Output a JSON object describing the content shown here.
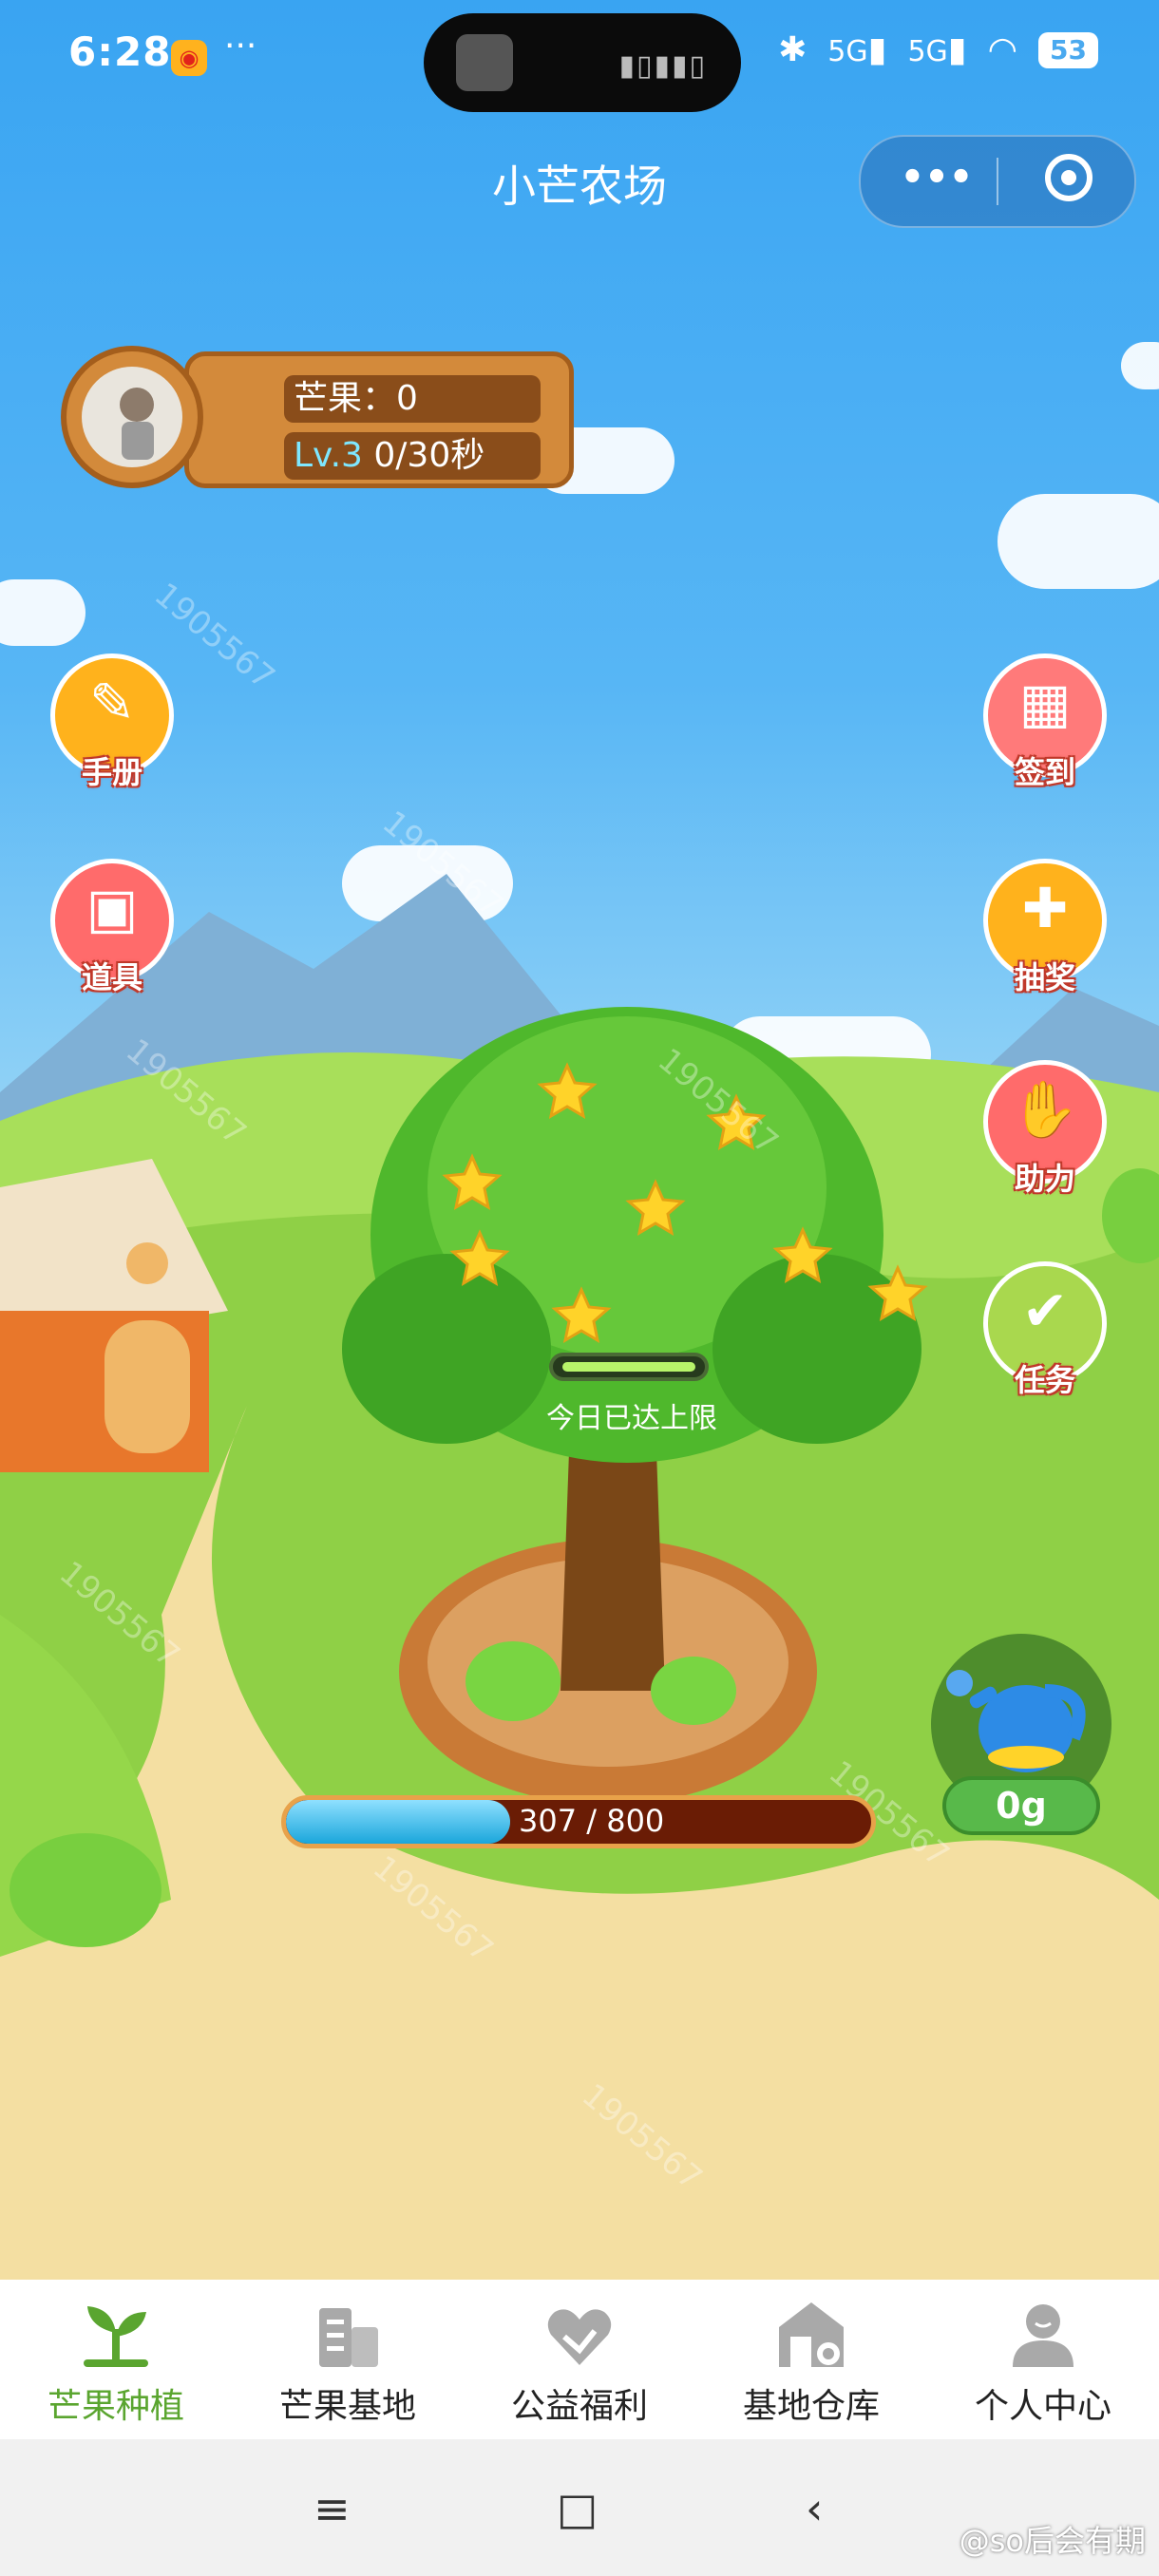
{
  "status_bar": {
    "time": "6:28",
    "more": "···",
    "network1": "5G",
    "network2": "5G",
    "battery": "53"
  },
  "header": {
    "title": "小芒农场",
    "more_label": "•••"
  },
  "profile": {
    "mango_label": "芒果：0",
    "level": "Lv.3",
    "timer": "0/30秒"
  },
  "left_buttons": [
    {
      "label": "手册",
      "icon": "handbook-icon"
    },
    {
      "label": "道具",
      "icon": "treasure-chest-icon"
    }
  ],
  "right_buttons": [
    {
      "label": "签到",
      "icon": "calendar-icon"
    },
    {
      "label": "抽奖",
      "icon": "gift-icon"
    },
    {
      "label": "助力",
      "icon": "handshake-icon"
    },
    {
      "label": "任务",
      "icon": "task-icon"
    }
  ],
  "tree": {
    "limit_text": "今日已达上限"
  },
  "progress": {
    "current": 307,
    "max": 800,
    "text": "307 / 800"
  },
  "watering": {
    "amount": "0g",
    "icon": "watering-can-icon"
  },
  "watermark": "1905567",
  "tabs": [
    {
      "label": "芒果种植",
      "icon": "sprout-icon",
      "active": true
    },
    {
      "label": "芒果基地",
      "icon": "buildings-icon",
      "active": false
    },
    {
      "label": "公益福利",
      "icon": "heart-hands-icon",
      "active": false
    },
    {
      "label": "基地仓库",
      "icon": "warehouse-icon",
      "active": false
    },
    {
      "label": "个人中心",
      "icon": "user-icon",
      "active": false
    }
  ],
  "system_nav": {
    "menu": "≡",
    "home": "□",
    "back": "‹"
  },
  "weibo_watermark": "@so后会有期",
  "colors": {
    "accent_green": "#5aa52f",
    "sky": "#39a4f2",
    "wood": "#d38a3b"
  }
}
